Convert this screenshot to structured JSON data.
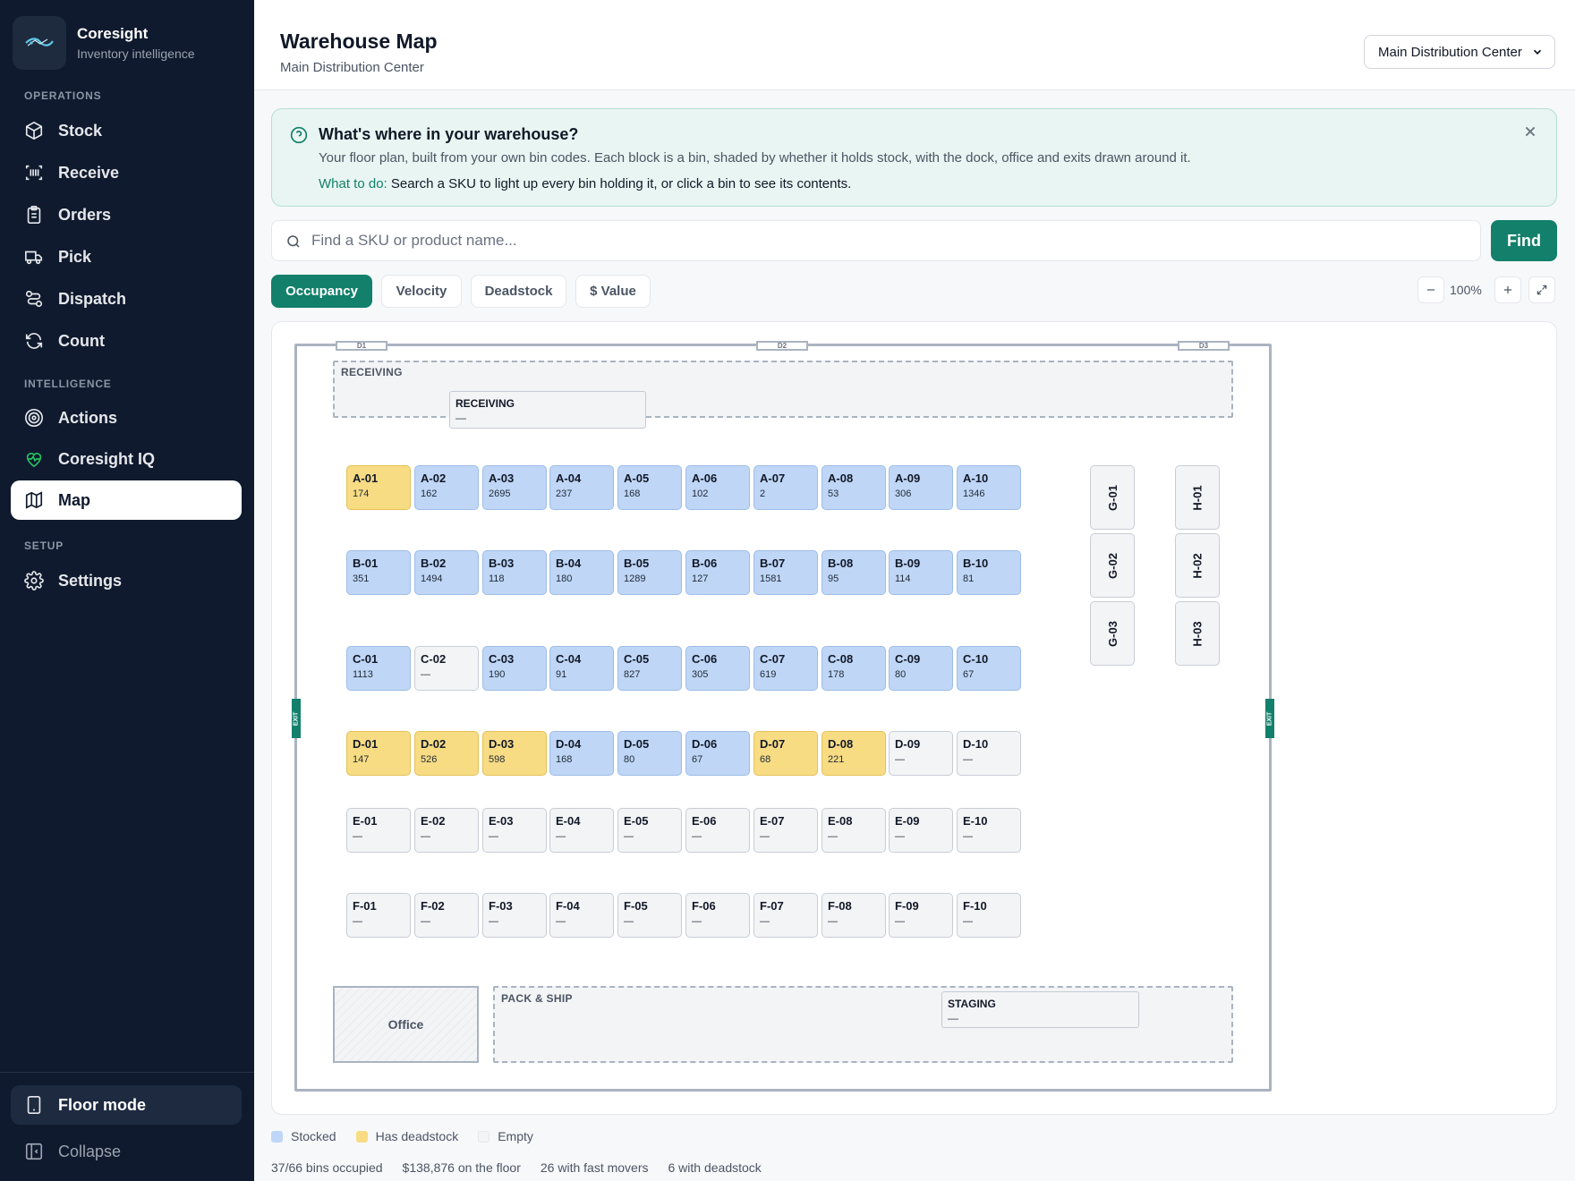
{
  "app": {
    "name": "Coresight",
    "tagline": "Inventory intelligence"
  },
  "sidebar": {
    "sections": [
      {
        "title": "OPERATIONS",
        "items": [
          {
            "label": "Stock",
            "icon": "box-icon"
          },
          {
            "label": "Receive",
            "icon": "scan-icon"
          },
          {
            "label": "Orders",
            "icon": "clipboard-icon"
          },
          {
            "label": "Pick",
            "icon": "truck-icon"
          },
          {
            "label": "Dispatch",
            "icon": "route-icon"
          },
          {
            "label": "Count",
            "icon": "refresh-icon"
          }
        ]
      },
      {
        "title": "INTELLIGENCE",
        "items": [
          {
            "label": "Actions",
            "icon": "target-icon"
          },
          {
            "label": "Coresight IQ",
            "icon": "heartbeat-icon"
          },
          {
            "label": "Map",
            "icon": "map-icon",
            "active": true
          }
        ]
      },
      {
        "title": "SETUP",
        "items": [
          {
            "label": "Settings",
            "icon": "gear-icon"
          }
        ]
      }
    ],
    "floor_mode": "Floor mode",
    "collapse": "Collapse"
  },
  "header": {
    "title": "Warehouse Map",
    "subtitle": "Main Distribution Center",
    "location_select": "Main Distribution Center"
  },
  "banner": {
    "title": "What's where in your warehouse?",
    "description": "Your floor plan, built from your own bin codes. Each block is a bin, shaded by whether it holds stock, with the dock, office and exits drawn around it.",
    "todo_label": "What to do:",
    "todo_text": "Search a SKU to light up every bin holding it, or click a bin to see its contents."
  },
  "search": {
    "placeholder": "Find a SKU or product name...",
    "value": "",
    "button": "Find"
  },
  "modes": [
    {
      "label": "Occupancy",
      "active": true
    },
    {
      "label": "Velocity",
      "active": false
    },
    {
      "label": "Deadstock",
      "active": false
    },
    {
      "label": "$ Value",
      "active": false
    }
  ],
  "zoom": {
    "level": "100%"
  },
  "map": {
    "docks": [
      "D1",
      "D2",
      "D3"
    ],
    "exits": [
      "EXIT",
      "EXIT"
    ],
    "receiving_zone": "RECEIVING",
    "receiving_area": {
      "name": "RECEIVING",
      "value": "—"
    },
    "pack_zone": "PACK & SHIP",
    "staging_area": {
      "name": "STAGING",
      "value": "—"
    },
    "office": "Office",
    "rows": [
      {
        "bins": [
          {
            "code": "A-01",
            "qty": "174",
            "state": "dead"
          },
          {
            "code": "A-02",
            "qty": "162",
            "state": "stocked"
          },
          {
            "code": "A-03",
            "qty": "2695",
            "state": "stocked"
          },
          {
            "code": "A-04",
            "qty": "237",
            "state": "stocked"
          },
          {
            "code": "A-05",
            "qty": "168",
            "state": "stocked"
          },
          {
            "code": "A-06",
            "qty": "102",
            "state": "stocked"
          },
          {
            "code": "A-07",
            "qty": "2",
            "state": "stocked"
          },
          {
            "code": "A-08",
            "qty": "53",
            "state": "stocked"
          },
          {
            "code": "A-09",
            "qty": "306",
            "state": "stocked"
          },
          {
            "code": "A-10",
            "qty": "1346",
            "state": "stocked"
          }
        ]
      },
      {
        "bins": [
          {
            "code": "B-01",
            "qty": "351",
            "state": "stocked"
          },
          {
            "code": "B-02",
            "qty": "1494",
            "state": "stocked"
          },
          {
            "code": "B-03",
            "qty": "118",
            "state": "stocked"
          },
          {
            "code": "B-04",
            "qty": "180",
            "state": "stocked"
          },
          {
            "code": "B-05",
            "qty": "1289",
            "state": "stocked"
          },
          {
            "code": "B-06",
            "qty": "127",
            "state": "stocked"
          },
          {
            "code": "B-07",
            "qty": "1581",
            "state": "stocked"
          },
          {
            "code": "B-08",
            "qty": "95",
            "state": "stocked"
          },
          {
            "code": "B-09",
            "qty": "114",
            "state": "stocked"
          },
          {
            "code": "B-10",
            "qty": "81",
            "state": "stocked"
          }
        ]
      },
      {
        "bins": [
          {
            "code": "C-01",
            "qty": "1113",
            "state": "stocked"
          },
          {
            "code": "C-02",
            "qty": "—",
            "state": "empty"
          },
          {
            "code": "C-03",
            "qty": "190",
            "state": "stocked"
          },
          {
            "code": "C-04",
            "qty": "91",
            "state": "stocked"
          },
          {
            "code": "C-05",
            "qty": "827",
            "state": "stocked"
          },
          {
            "code": "C-06",
            "qty": "305",
            "state": "stocked"
          },
          {
            "code": "C-07",
            "qty": "619",
            "state": "stocked"
          },
          {
            "code": "C-08",
            "qty": "178",
            "state": "stocked"
          },
          {
            "code": "C-09",
            "qty": "80",
            "state": "stocked"
          },
          {
            "code": "C-10",
            "qty": "67",
            "state": "stocked"
          }
        ]
      },
      {
        "bins": [
          {
            "code": "D-01",
            "qty": "147",
            "state": "dead"
          },
          {
            "code": "D-02",
            "qty": "526",
            "state": "dead"
          },
          {
            "code": "D-03",
            "qty": "598",
            "state": "dead"
          },
          {
            "code": "D-04",
            "qty": "168",
            "state": "stocked"
          },
          {
            "code": "D-05",
            "qty": "80",
            "state": "stocked"
          },
          {
            "code": "D-06",
            "qty": "67",
            "state": "stocked"
          },
          {
            "code": "D-07",
            "qty": "68",
            "state": "dead"
          },
          {
            "code": "D-08",
            "qty": "221",
            "state": "dead"
          },
          {
            "code": "D-09",
            "qty": "—",
            "state": "empty"
          },
          {
            "code": "D-10",
            "qty": "—",
            "state": "empty"
          }
        ]
      },
      {
        "bins": [
          {
            "code": "E-01",
            "qty": "—",
            "state": "empty"
          },
          {
            "code": "E-02",
            "qty": "—",
            "state": "empty"
          },
          {
            "code": "E-03",
            "qty": "—",
            "state": "empty"
          },
          {
            "code": "E-04",
            "qty": "—",
            "state": "empty"
          },
          {
            "code": "E-05",
            "qty": "—",
            "state": "empty"
          },
          {
            "code": "E-06",
            "qty": "—",
            "state": "empty"
          },
          {
            "code": "E-07",
            "qty": "—",
            "state": "empty"
          },
          {
            "code": "E-08",
            "qty": "—",
            "state": "empty"
          },
          {
            "code": "E-09",
            "qty": "—",
            "state": "empty"
          },
          {
            "code": "E-10",
            "qty": "—",
            "state": "empty"
          }
        ]
      },
      {
        "bins": [
          {
            "code": "F-01",
            "qty": "—",
            "state": "empty"
          },
          {
            "code": "F-02",
            "qty": "—",
            "state": "empty"
          },
          {
            "code": "F-03",
            "qty": "—",
            "state": "empty"
          },
          {
            "code": "F-04",
            "qty": "—",
            "state": "empty"
          },
          {
            "code": "F-05",
            "qty": "—",
            "state": "empty"
          },
          {
            "code": "F-06",
            "qty": "—",
            "state": "empty"
          },
          {
            "code": "F-07",
            "qty": "—",
            "state": "empty"
          },
          {
            "code": "F-08",
            "qty": "—",
            "state": "empty"
          },
          {
            "code": "F-09",
            "qty": "—",
            "state": "empty"
          },
          {
            "code": "F-10",
            "qty": "—",
            "state": "empty"
          }
        ]
      }
    ],
    "vertical_columns": [
      {
        "bins": [
          "G-01",
          "G-02",
          "G-03"
        ]
      },
      {
        "bins": [
          "H-01",
          "H-02",
          "H-03"
        ]
      }
    ]
  },
  "legend": [
    {
      "label": "Stocked",
      "color": "#bfd6f6"
    },
    {
      "label": "Has deadstock",
      "color": "#f8dc84"
    },
    {
      "label": "Empty",
      "color": "#f3f4f6"
    }
  ],
  "stats": [
    "37/66 bins occupied",
    "$138,876 on the floor",
    "26 with fast movers",
    "6 with deadstock"
  ],
  "colors": {
    "sidebar": "#0f1a2e",
    "accent": "#13806b",
    "stocked": "#bfd6f6",
    "deadstock": "#f8dc84",
    "empty": "#f3f4f6"
  }
}
